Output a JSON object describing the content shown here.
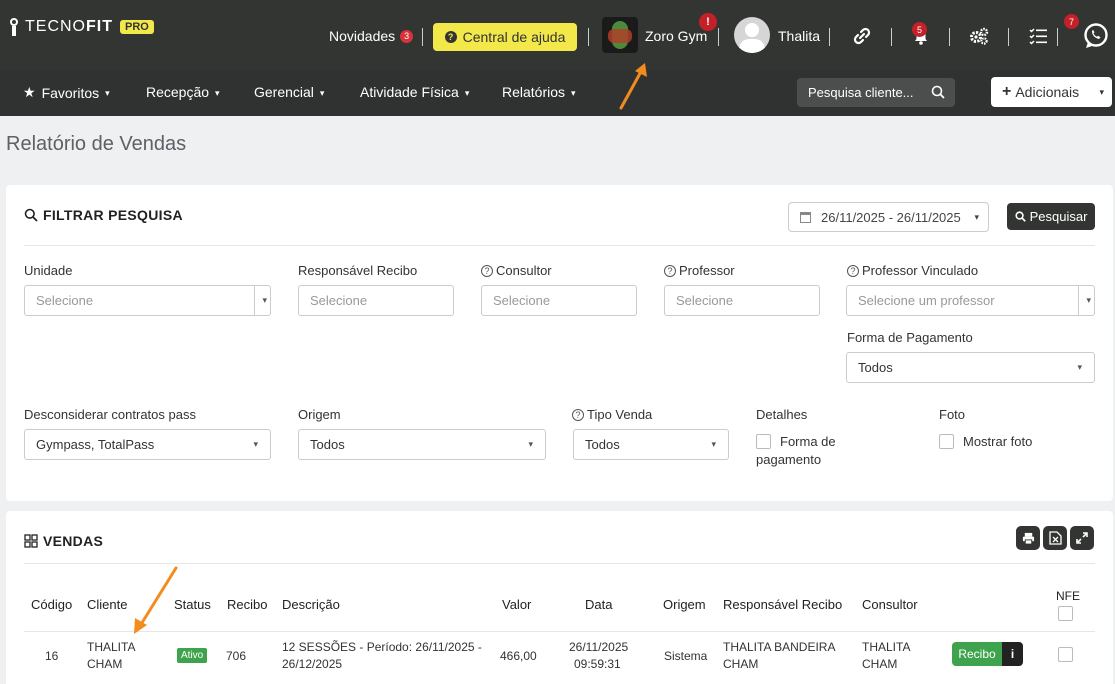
{
  "topbar": {
    "logo_text_light": "TECNO",
    "logo_text_bold": "FIT",
    "logo_badge": "PRO",
    "news_label": "Novidades",
    "news_count": "3",
    "help_label": "Central de ajuda",
    "gym_name": "Zoro Gym",
    "gym_alert": "!",
    "user_name": "Thalita",
    "notifications_count": "5",
    "tasks_count": "7"
  },
  "menu": {
    "items": [
      {
        "label": "Favoritos"
      },
      {
        "label": "Recepção"
      },
      {
        "label": "Gerencial"
      },
      {
        "label": "Atividade Física"
      },
      {
        "label": "Relatórios"
      }
    ],
    "search_placeholder": "Pesquisa cliente...",
    "add_label": "Adicionais"
  },
  "page": {
    "title": "Relatório de Vendas"
  },
  "filter": {
    "title": "FILTRAR PESQUISA",
    "date_range": "26/11/2025 - 26/11/2025",
    "search_button": "Pesquisar",
    "fields": {
      "unidade": {
        "label": "Unidade",
        "value": "Selecione"
      },
      "responsavel": {
        "label": "Responsável Recibo",
        "value": "Selecione"
      },
      "consultor": {
        "label": "Consultor",
        "value": "Selecione"
      },
      "professor": {
        "label": "Professor",
        "value": "Selecione"
      },
      "professor_vinculado": {
        "label": "Professor Vinculado",
        "value": "Selecione um professor"
      },
      "forma_pagamento": {
        "label": "Forma de Pagamento",
        "value": "Todos"
      },
      "desconsiderar": {
        "label": "Desconsiderar contratos pass",
        "value": "Gympass, TotalPass"
      },
      "origem": {
        "label": "Origem",
        "value": "Todos"
      },
      "tipo_venda": {
        "label": "Tipo Venda",
        "value": "Todos"
      },
      "detalhes": {
        "label": "Detalhes",
        "option_line1": "Forma de",
        "option_line2": "pagamento"
      },
      "foto": {
        "label": "Foto",
        "option": "Mostrar foto"
      }
    }
  },
  "sales": {
    "title": "VENDAS",
    "columns": [
      "Código",
      "Cliente",
      "Status",
      "Recibo",
      "Descrição",
      "Valor",
      "Data",
      "Origem",
      "Responsável Recibo",
      "Consultor",
      "NFE"
    ],
    "rows": [
      {
        "codigo": "16",
        "cliente_1": "THALITA",
        "cliente_2": "CHAM",
        "status": "Ativo",
        "recibo": "706",
        "descricao_1": "12 SESSÕES - Período: 26/11/2025 -",
        "descricao_2": "26/12/2025",
        "valor": "466,00",
        "data_1": "26/11/2025",
        "data_2": "09:59:31",
        "origem": "Sistema",
        "responsavel_1": "THALITA BANDEIRA",
        "responsavel_2": "CHAM",
        "consultor_1": "THALITA",
        "consultor_2": "CHAM",
        "recibo_button": "Recibo",
        "info_button": "i"
      }
    ]
  },
  "colors": {
    "topbar": "#333533",
    "menubar": "#2f3230",
    "accent_yellow": "#f2e84a",
    "badge_red": "#c4202a",
    "success_green": "#3fa34d",
    "annotation_arrow": "#f28c1e"
  }
}
